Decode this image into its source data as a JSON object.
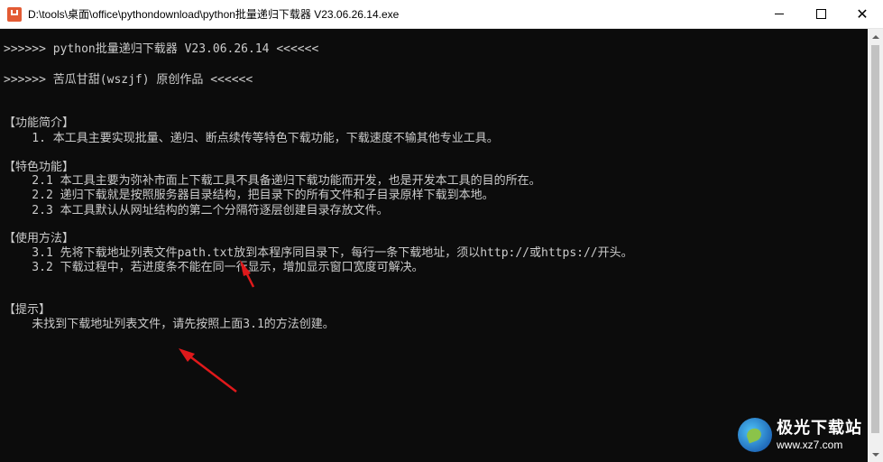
{
  "window": {
    "title": "D:\\tools\\桌面\\office\\pythondownload\\python批量递归下载器 V23.06.26.14.exe",
    "minimize_label": "",
    "maximize_label": "",
    "close_label": "✕"
  },
  "console": {
    "lines": [
      ">>>>>> python批量递归下载器 V23.06.26.14 <<<<<<",
      ">>>>>> 苦瓜甘甜(wszjf) 原创作品 <<<<<<",
      "【功能简介】",
      "    1. 本工具主要实现批量、递归、断点续传等特色下载功能，下载速度不输其他专业工具。",
      "【特色功能】",
      "    2.1 本工具主要为弥补市面上下载工具不具备递归下载功能而开发，也是开发本工具的目的所在。",
      "    2.2 递归下载就是按照服务器目录结构，把目录下的所有文件和子目录原样下载到本地。",
      "    2.3 本工具默认从网址结构的第二个分隔符逐层创建目录存放文件。",
      "【使用方法】",
      "    3.1 先将下载地址列表文件path.txt放到本程序同目录下，每行一条下载地址，须以http://或https://开头。",
      "    3.2 下载过程中，若进度条不能在同一行显示，增加显示窗口宽度可解决。",
      "【提示】",
      "    未找到下载地址列表文件，请先按照上面3.1的方法创建。"
    ]
  },
  "watermark": {
    "brand": "极光下载站",
    "url": "www.xz7.com"
  },
  "colors": {
    "console_bg": "#0c0c0c",
    "console_text": "#cccccc",
    "annotation_arrow": "#e0191b"
  }
}
